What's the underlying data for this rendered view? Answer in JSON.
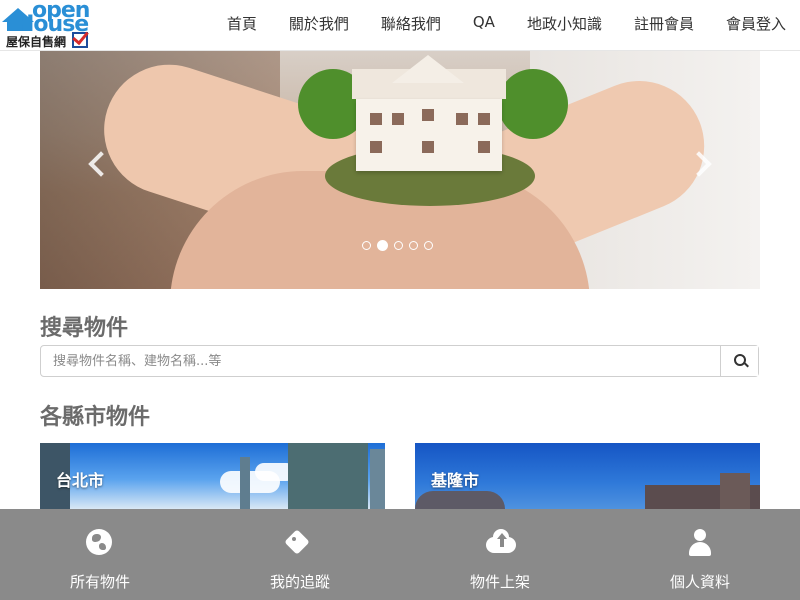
{
  "header": {
    "logo": {
      "line1": "open",
      "line2": "House",
      "tagline": "屋保自售網"
    },
    "nav": [
      "首頁",
      "關於我們",
      "聯絡我們",
      "QA",
      "地政小知識",
      "註冊會員",
      "會員登入"
    ]
  },
  "carousel": {
    "slide_count": 5,
    "active_index": 1
  },
  "search": {
    "title": "搜尋物件",
    "placeholder": "搜尋物件名稱、建物名稱...等"
  },
  "cities": {
    "title": "各縣市物件",
    "items": [
      {
        "name": "台北市"
      },
      {
        "name": "基隆市"
      }
    ]
  },
  "bottom_nav": [
    {
      "label": "所有物件",
      "icon": "globe-icon"
    },
    {
      "label": "我的追蹤",
      "icon": "tag-icon"
    },
    {
      "label": "物件上架",
      "icon": "cloud-upload-icon"
    },
    {
      "label": "個人資料",
      "icon": "user-icon"
    }
  ],
  "colors": {
    "accent": "#2a8fd6",
    "bottom_bar": "#8a8a8a",
    "section_title": "#6b6b6b"
  }
}
